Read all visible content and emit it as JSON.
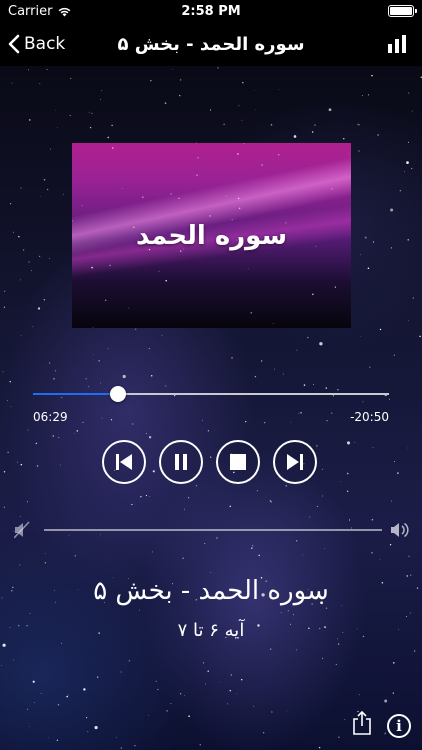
{
  "status_bar": {
    "carrier": "Carrier",
    "time": "2:58 PM"
  },
  "nav": {
    "back_label": "Back",
    "title": "سوره الحمد - بخش ۵",
    "chart_icon": "bar-chart-icon"
  },
  "artwork": {
    "title": "سوره الحمد"
  },
  "player": {
    "elapsed": "06:29",
    "remaining": "-20:50",
    "progress_fraction": 0.24,
    "volume_fraction": 0.0,
    "controls": [
      "previous-icon",
      "pause-icon",
      "stop-icon",
      "next-icon"
    ]
  },
  "track": {
    "title": "سوره الحمد - بخش ۵",
    "subtitle": "آیه ۶ تا ۷"
  },
  "footer": {
    "share_icon": "share-icon",
    "info_icon": "info-icon",
    "info_glyph": "i"
  },
  "colors": {
    "accent": "#1e6ef2",
    "bar_bg": "#000000"
  }
}
